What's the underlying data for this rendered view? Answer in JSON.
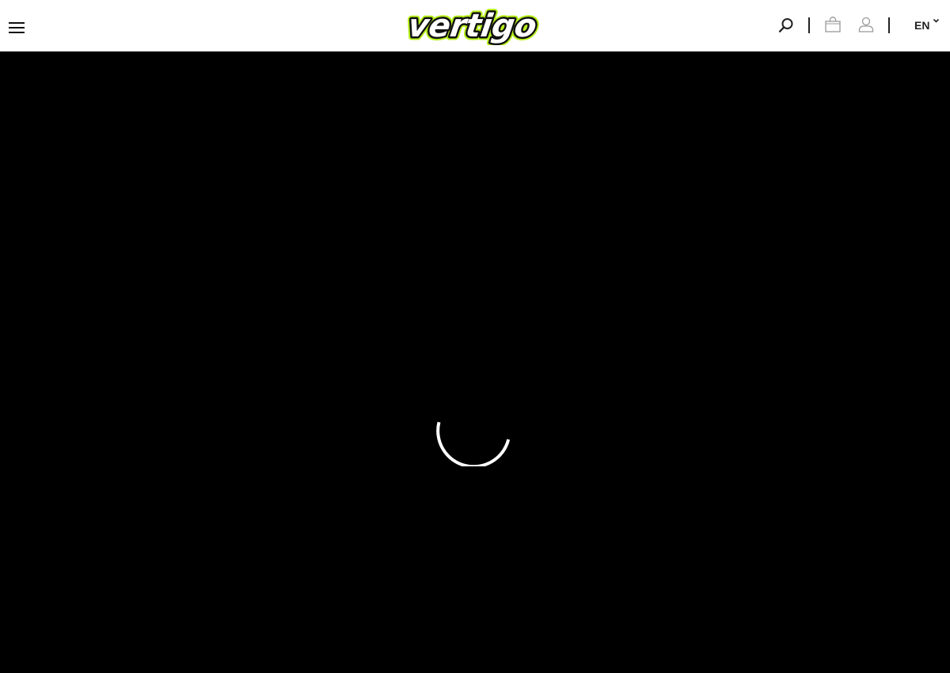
{
  "header": {
    "menu_icon": "hamburger-menu-icon",
    "logo_text": "vertigo",
    "logo_colors": {
      "fill": "#ffffff",
      "outline": "#111111",
      "glow": "#b6f01b"
    },
    "search_icon": "search-icon",
    "cart_icon": "shopping-bag-icon",
    "account_icon": "user-icon",
    "language": {
      "selected": "EN",
      "icon": "chevron-down-icon"
    }
  },
  "main": {
    "background_color": "#000000",
    "loading_icon": "loading-spinner-icon"
  }
}
